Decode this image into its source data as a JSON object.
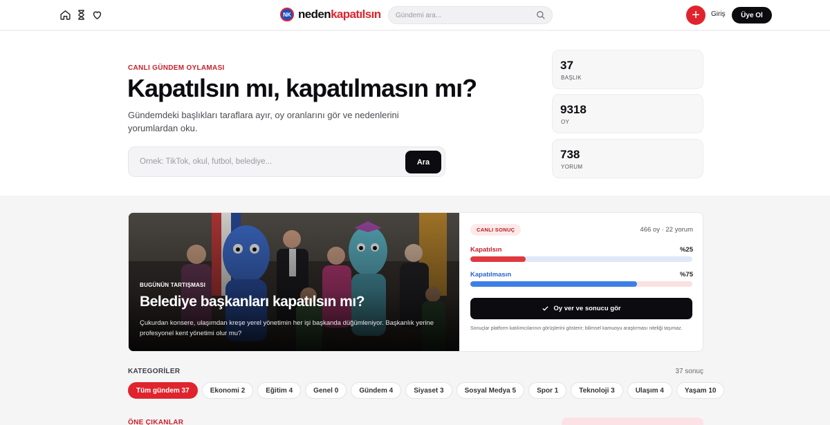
{
  "header": {
    "brand_prefix": "neden",
    "brand_suffix": "kapatılsın",
    "brand_badge": "NK",
    "search_placeholder": "Gündemi ara...",
    "login_label": "Giriş",
    "signup_label": "Üye Ol",
    "plus_label": "+"
  },
  "hero": {
    "eyebrow": "CANLI GÜNDEM OYLAMASI",
    "title": "Kapatılsın mı, kapatılmasın mı?",
    "description": "Gündemdeki başlıkları taraflara ayır, oy oranlarını gör ve nedenlerini yorumlardan oku.",
    "search_placeholder": "Örnek: TikTok, okul, futbol, belediye...",
    "search_button": "Ara"
  },
  "stats": [
    {
      "value": "37",
      "label": "BAŞLIK"
    },
    {
      "value": "9318",
      "label": "OY"
    },
    {
      "value": "738",
      "label": "YORUM"
    }
  ],
  "featured": {
    "tag": "BUGÜNÜN TARTIŞMASI",
    "title": "Belediye başkanları kapatılsın mı?",
    "description": "Çukurdan konsere, ulaşımdan kreşe yerel yönetimin her işi başkanda düğümleniyor. Başkanlık yerine profesyonel kent yönetimi olur mu?",
    "live_badge": "CANLI SONUÇ",
    "meta": "466 oy · 22 yorum",
    "options": [
      {
        "label": "Kapatılsın",
        "percent_text": "%25",
        "fraction": 0.25,
        "color": "#e0383f",
        "track": "#dfe8f8"
      },
      {
        "label": "Kapatılmasın",
        "percent_text": "%75",
        "fraction": 0.75,
        "color": "#3d7fe6",
        "track": "#fbe0e1"
      }
    ],
    "vote_button": "Oy ver ve sonucu gör",
    "note": "Sonuçlar platform katılımcılarının görüşlerini gösterir; bilimsel kamuoyu araştırması niteliği taşımaz."
  },
  "categories": {
    "heading": "KATEGORİLER",
    "count": "37 sonuç",
    "chips": [
      {
        "label": "Tüm gündem 37",
        "active": true
      },
      {
        "label": "Ekonomi 2",
        "active": false
      },
      {
        "label": "Eğitim 4",
        "active": false
      },
      {
        "label": "Genel 0",
        "active": false
      },
      {
        "label": "Gündem 4",
        "active": false
      },
      {
        "label": "Siyaset 3",
        "active": false
      },
      {
        "label": "Sosyal Medya 5",
        "active": false
      },
      {
        "label": "Spor 1",
        "active": false
      },
      {
        "label": "Teknoloji 3",
        "active": false
      },
      {
        "label": "Ulaşım 4",
        "active": false
      },
      {
        "label": "Yaşam 10",
        "active": false
      }
    ]
  },
  "next_section": {
    "heading": "ÖNE ÇIKANLAR"
  }
}
